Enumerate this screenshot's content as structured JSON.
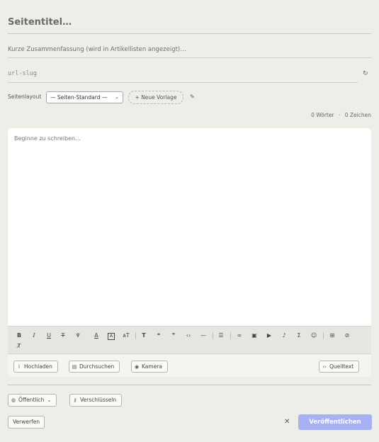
{
  "form": {
    "title_placeholder": "Seitentitel…",
    "summary_placeholder": "Kurze Zusammenfassung (wird in Artikellisten angezeigt)…",
    "slug_placeholder": "url-slug"
  },
  "layout": {
    "label": "Seitenlayout",
    "selected": "— Seiten-Standard —",
    "new_template": "+ Neue Vorlage"
  },
  "counts": {
    "words": "0 Wörter",
    "separator": "·",
    "chars": "0 Zeichen"
  },
  "editor": {
    "placeholder": "Beginne zu schreiben…"
  },
  "toolbar": {
    "icons": [
      "bold-icon",
      "italic-icon",
      "underline-icon",
      "strikethrough-icon",
      "highlight-icon",
      "text-color-icon",
      "background-color-icon",
      "font-size-icon",
      "heading-icon",
      "quote-icon",
      "blockquote-icon",
      "code-icon",
      "horizontal-rule-icon",
      "list-icon",
      "link-icon",
      "image-icon",
      "video-icon",
      "audio-icon",
      "formula-icon",
      "emoji-icon",
      "table-icon",
      "hide-icon",
      "clear-format-icon"
    ]
  },
  "attachments": {
    "upload": "Hochladen",
    "browse": "Durchsuchen",
    "camera": "Kamera",
    "source": "Quelltext"
  },
  "footer": {
    "visibility": "Öffentlich",
    "encrypt": "Verschlüsseln",
    "discard": "Verwerfen",
    "publish": "Veröffentlichen"
  },
  "colors": {
    "background": "#eeeee9",
    "publish_button": "#a7b2f4"
  }
}
